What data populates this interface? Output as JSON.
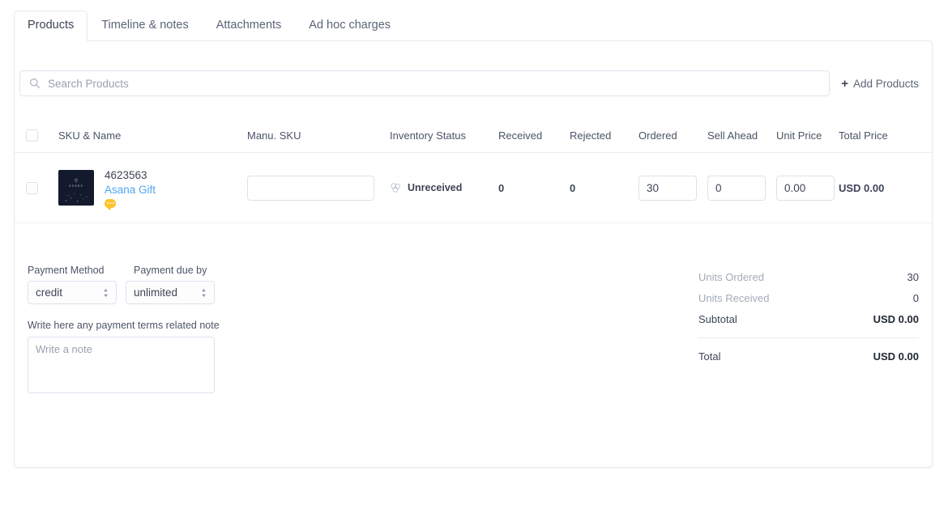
{
  "tabs": [
    {
      "label": "Products",
      "active": true
    },
    {
      "label": "Timeline & notes",
      "active": false
    },
    {
      "label": "Attachments",
      "active": false
    },
    {
      "label": "Ad hoc charges",
      "active": false
    }
  ],
  "search": {
    "placeholder": "Search Products",
    "value": "",
    "icon": "search-icon"
  },
  "add_products": {
    "label": "Add Products",
    "plus": "+"
  },
  "table": {
    "columns": [
      "SKU & Name",
      "Manu. SKU",
      "Inventory Status",
      "Received",
      "Rejected",
      "Ordered",
      "Sell Ahead",
      "Unit Price",
      "Total Price"
    ],
    "rows": [
      {
        "sku": "4623563",
        "name": "Asana Gift",
        "thumbnail_brand": "ASANA",
        "note_badge_icon": "chat-bubble-icon",
        "manu_sku_value": "",
        "manu_sku_placeholder": "",
        "inventory_status": "Unreceived",
        "inventory_status_icon": "boxes-icon",
        "received": "0",
        "rejected": "0",
        "ordered": "30",
        "sell_ahead": "0",
        "unit_price": "0.00",
        "total_price": "USD 0.00"
      }
    ]
  },
  "payment": {
    "method_label": "Payment Method",
    "method_value": "credit",
    "due_label": "Payment due by",
    "due_value": "unlimited",
    "note_label": "Write here any payment terms related note",
    "note_placeholder": "Write a note",
    "note_value": ""
  },
  "totals": {
    "units_ordered_label": "Units Ordered",
    "units_ordered_value": "30",
    "units_received_label": "Units Received",
    "units_received_value": "0",
    "subtotal_label": "Subtotal",
    "subtotal_value": "USD 0.00",
    "total_label": "Total",
    "total_value": "USD 0.00"
  },
  "colors": {
    "link": "#4fa6ef",
    "badge": "#fcc42c",
    "text": "#3d4456",
    "muted": "#a3aab8",
    "border": "#e6e9ee"
  }
}
